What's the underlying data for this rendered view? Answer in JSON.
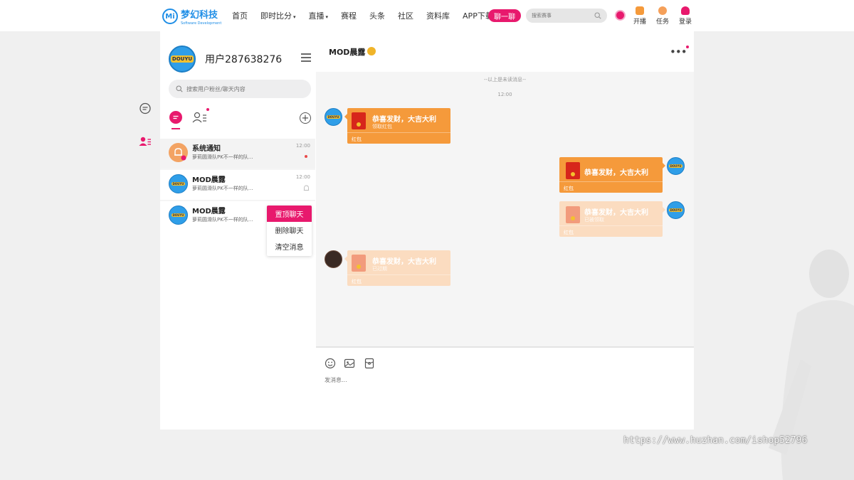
{
  "brand": {
    "badge": "Mi",
    "name": "梦幻科技",
    "tagline": "Software Development"
  },
  "nav": [
    {
      "label": "首页",
      "caret": ""
    },
    {
      "label": "即时比分",
      "caret": "▾"
    },
    {
      "label": "直播",
      "caret": "▾"
    },
    {
      "label": "赛程",
      "caret": ""
    },
    {
      "label": "头条",
      "caret": ""
    },
    {
      "label": "社区",
      "caret": ""
    },
    {
      "label": "资料库",
      "caret": ""
    },
    {
      "label": "APP下载",
      "caret": ""
    }
  ],
  "chat_button": "聊一聊",
  "search": {
    "placeholder": "搜索赛事"
  },
  "top_tools": {
    "broadcast": "开播",
    "tasks": "任务",
    "login": "登录"
  },
  "user": {
    "name": "用户287638276",
    "avatar_text": "DOUYU"
  },
  "list_search": {
    "placeholder": "搜索用户粉丝/聊天内容"
  },
  "add_symbol": "+",
  "conversations": [
    {
      "title": "系统通知",
      "preview": "萝莉圆滑队PK不一样的队...",
      "time": "12:00"
    },
    {
      "title": "MOD晨露",
      "preview": "萝莉圆滑队PK不一样的队...",
      "time": "12:00"
    },
    {
      "title": "MOD晨露",
      "preview": "萝莉圆滑队PK不一样的队...",
      "time": ""
    }
  ],
  "context_menu": [
    "置顶聊天",
    "删除聊天",
    "清空消息"
  ],
  "chat": {
    "title": "MOD晨露",
    "more": "•••",
    "unread_divider": "--以上是未读消息--",
    "time": "12:00",
    "messages": [
      {
        "side": "left",
        "wish": "恭喜发财，大吉大利",
        "status": "领取红包",
        "footer": "红包",
        "faded": false
      },
      {
        "side": "right",
        "wish": "恭喜发财，大吉大利",
        "status": "",
        "footer": "红包",
        "faded": false
      },
      {
        "side": "right",
        "wish": "恭喜发财，大吉大利",
        "status": "已被领取",
        "footer": "红包",
        "faded": true
      },
      {
        "side": "left",
        "wish": "恭喜发财，大吉大利",
        "status": "已过期",
        "footer": "红包",
        "faded": true
      }
    ],
    "compose_placeholder": "发消息..."
  },
  "watermark": "https://www.huzhan.com/ishop52796",
  "colors": {
    "accent": "#e8196d",
    "red_packet": "#f59a3b",
    "red_packet_faded": "#fbdcc0",
    "brand_blue": "#1f8ee6"
  }
}
